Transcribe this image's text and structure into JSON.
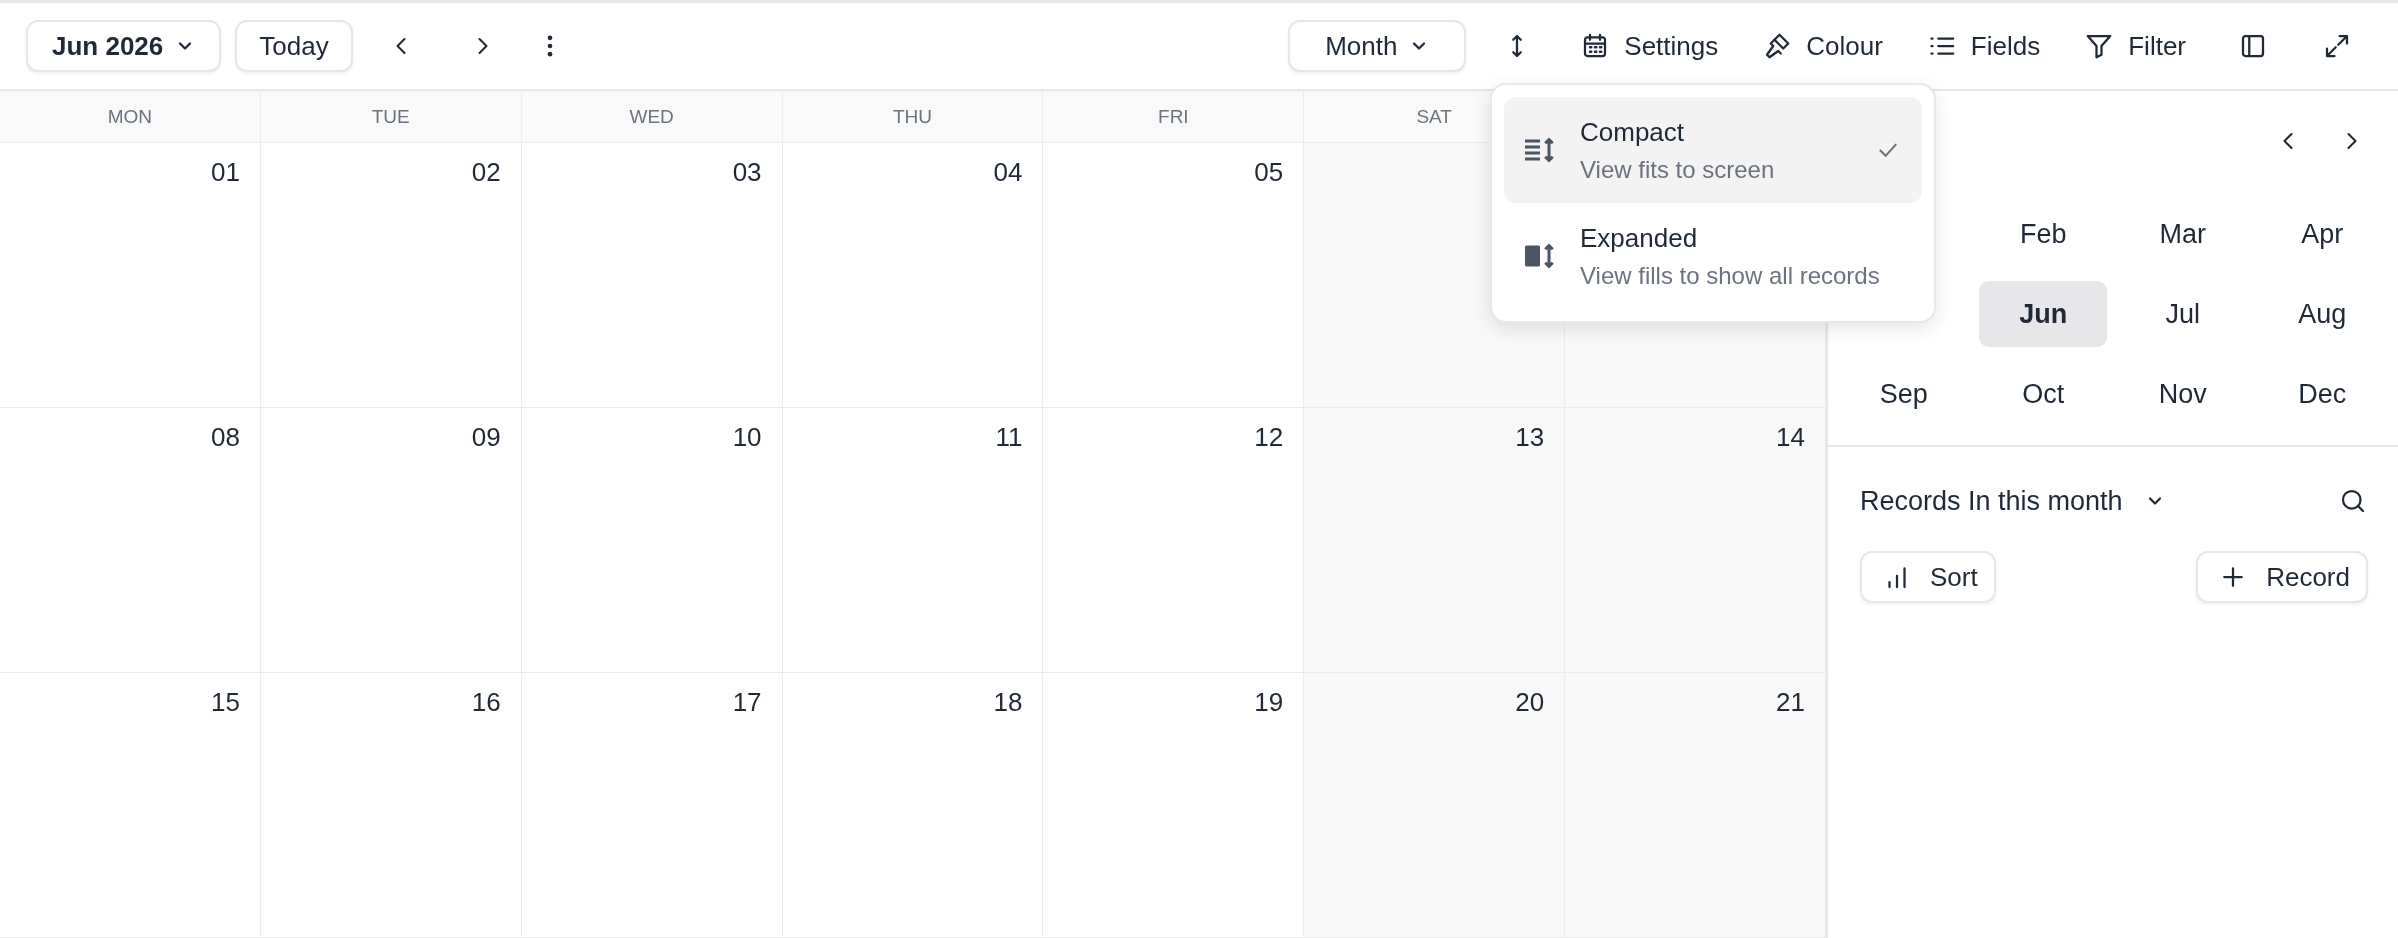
{
  "toolbar": {
    "date_button": "Jun 2026",
    "today_button": "Today",
    "view_button": "Month",
    "actions": [
      {
        "label": "Settings"
      },
      {
        "label": "Colour"
      },
      {
        "label": "Fields"
      },
      {
        "label": "Filter"
      }
    ]
  },
  "calendar": {
    "weekdays": [
      "MON",
      "TUE",
      "WED",
      "THU",
      "FRI",
      "SAT"
    ],
    "weeks": [
      {
        "days": [
          "01",
          "02",
          "03",
          "04",
          "05"
        ]
      },
      {
        "days": [
          "08",
          "09",
          "10",
          "11",
          "12",
          "13",
          "14"
        ]
      },
      {
        "days": [
          "15",
          "16",
          "17",
          "18",
          "19",
          "20",
          "21"
        ]
      }
    ]
  },
  "row_height_menu": {
    "options": [
      {
        "title": "Compact",
        "description": "View fits to screen",
        "selected": true
      },
      {
        "title": "Expanded",
        "description": "View fills to show all records",
        "selected": false
      }
    ]
  },
  "sidebar": {
    "month_rows": [
      [
        {
          "label": "Feb",
          "selected": false
        },
        {
          "label": "Mar",
          "selected": false
        },
        {
          "label": "Apr",
          "selected": false
        }
      ],
      [
        {
          "label": "Jun",
          "selected": true
        },
        {
          "label": "Jul",
          "selected": false
        },
        {
          "label": "Aug",
          "selected": false
        }
      ],
      [
        {
          "label": "Sep",
          "selected": false
        },
        {
          "label": "Oct",
          "selected": false
        },
        {
          "label": "Nov",
          "selected": false
        },
        {
          "label": "Dec",
          "selected": false
        }
      ]
    ],
    "records_title": "Records In this month",
    "sort_button": "Sort",
    "add_button": "Record"
  }
}
